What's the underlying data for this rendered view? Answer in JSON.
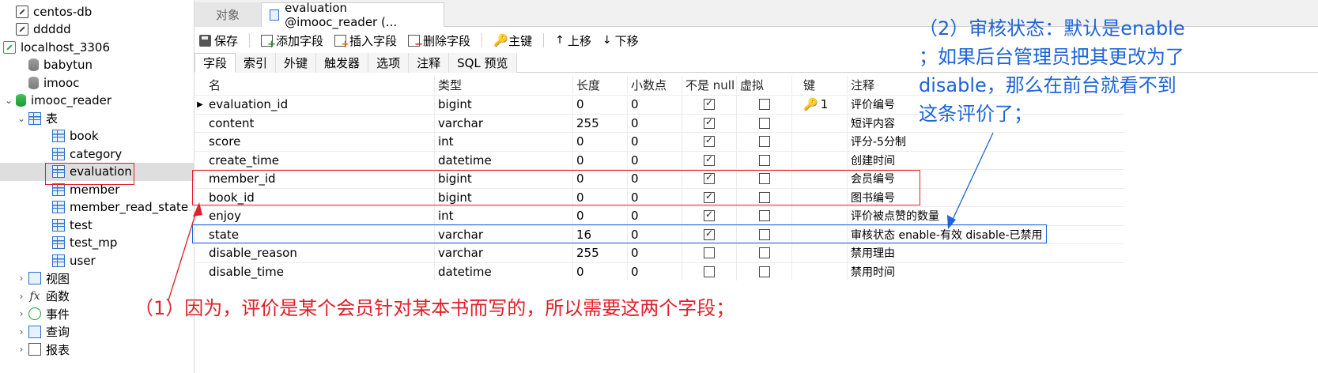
{
  "sidebar": {
    "items": [
      {
        "label": "centos-db",
        "icon": "connection-icon"
      },
      {
        "label": "ddddd",
        "icon": "connection-icon"
      },
      {
        "label": "localhost_3306",
        "icon": "connection-icon",
        "expanded": true
      },
      {
        "label": "babytun",
        "icon": "database-icon"
      },
      {
        "label": "imooc",
        "icon": "database-icon"
      },
      {
        "label": "imooc_reader",
        "icon": "database-icon",
        "expanded": true
      },
      {
        "label": "表",
        "icon": "table-icon",
        "expanded": true
      },
      {
        "label": "book",
        "icon": "table-icon"
      },
      {
        "label": "category",
        "icon": "table-icon"
      },
      {
        "label": "evaluation",
        "icon": "table-icon",
        "selected": true
      },
      {
        "label": "member",
        "icon": "table-icon"
      },
      {
        "label": "member_read_state",
        "icon": "table-icon"
      },
      {
        "label": "test",
        "icon": "table-icon"
      },
      {
        "label": "test_mp",
        "icon": "table-icon"
      },
      {
        "label": "user",
        "icon": "table-icon"
      },
      {
        "label": "视图",
        "icon": "view-icon"
      },
      {
        "label": "函数",
        "icon": "function-icon"
      },
      {
        "label": "事件",
        "icon": "event-icon"
      },
      {
        "label": "查询",
        "icon": "query-icon"
      },
      {
        "label": "报表",
        "icon": "report-icon"
      }
    ]
  },
  "tabs": {
    "objects": "对象",
    "active": "evaluation @imooc_reader (..."
  },
  "toolbar": {
    "save": "保存",
    "add_field": "添加字段",
    "insert_field": "插入字段",
    "delete_field": "删除字段",
    "primary_key": "主键",
    "move_up": "上移",
    "move_down": "下移"
  },
  "subtabs": [
    "字段",
    "索引",
    "外键",
    "触发器",
    "选项",
    "注释",
    "SQL 预览"
  ],
  "grid": {
    "columns": [
      "名",
      "类型",
      "长度",
      "小数点",
      "不是 null",
      "虚拟",
      "键",
      "注释"
    ],
    "rows": [
      {
        "name": "evaluation_id",
        "type": "bigint",
        "length": "0",
        "decimals": "0",
        "not_null": true,
        "virtual": false,
        "key": "1",
        "comment": "评价编号"
      },
      {
        "name": "content",
        "type": "varchar",
        "length": "255",
        "decimals": "0",
        "not_null": true,
        "virtual": false,
        "key": "",
        "comment": "短评内容"
      },
      {
        "name": "score",
        "type": "int",
        "length": "0",
        "decimals": "0",
        "not_null": true,
        "virtual": false,
        "key": "",
        "comment": "评分-5分制"
      },
      {
        "name": "create_time",
        "type": "datetime",
        "length": "0",
        "decimals": "0",
        "not_null": true,
        "virtual": false,
        "key": "",
        "comment": "创建时间"
      },
      {
        "name": "member_id",
        "type": "bigint",
        "length": "0",
        "decimals": "0",
        "not_null": true,
        "virtual": false,
        "key": "",
        "comment": "会员编号"
      },
      {
        "name": "book_id",
        "type": "bigint",
        "length": "0",
        "decimals": "0",
        "not_null": true,
        "virtual": false,
        "key": "",
        "comment": "图书编号"
      },
      {
        "name": "enjoy",
        "type": "int",
        "length": "0",
        "decimals": "0",
        "not_null": true,
        "virtual": false,
        "key": "",
        "comment": "评价被点赞的数量"
      },
      {
        "name": "state",
        "type": "varchar",
        "length": "16",
        "decimals": "0",
        "not_null": true,
        "virtual": false,
        "key": "",
        "comment": "审核状态 enable-有效 disable-已禁用"
      },
      {
        "name": "disable_reason",
        "type": "varchar",
        "length": "255",
        "decimals": "0",
        "not_null": false,
        "virtual": false,
        "key": "",
        "comment": "禁用理由"
      },
      {
        "name": "disable_time",
        "type": "datetime",
        "length": "0",
        "decimals": "0",
        "not_null": false,
        "virtual": false,
        "key": "",
        "comment": "禁用时间"
      }
    ]
  },
  "annotations": {
    "note1": "（1）因为，评价是某个会员针对某本书而写的，所以需要这两个字段；",
    "note2_lines": [
      "（2）审核状态：默认是enable",
      "；如果后台管理员把其更改为了",
      "disable，那么在前台就看不到",
      "这条评价了；"
    ],
    "red_color": "#e0202a",
    "blue_color": "#1e63d8"
  }
}
